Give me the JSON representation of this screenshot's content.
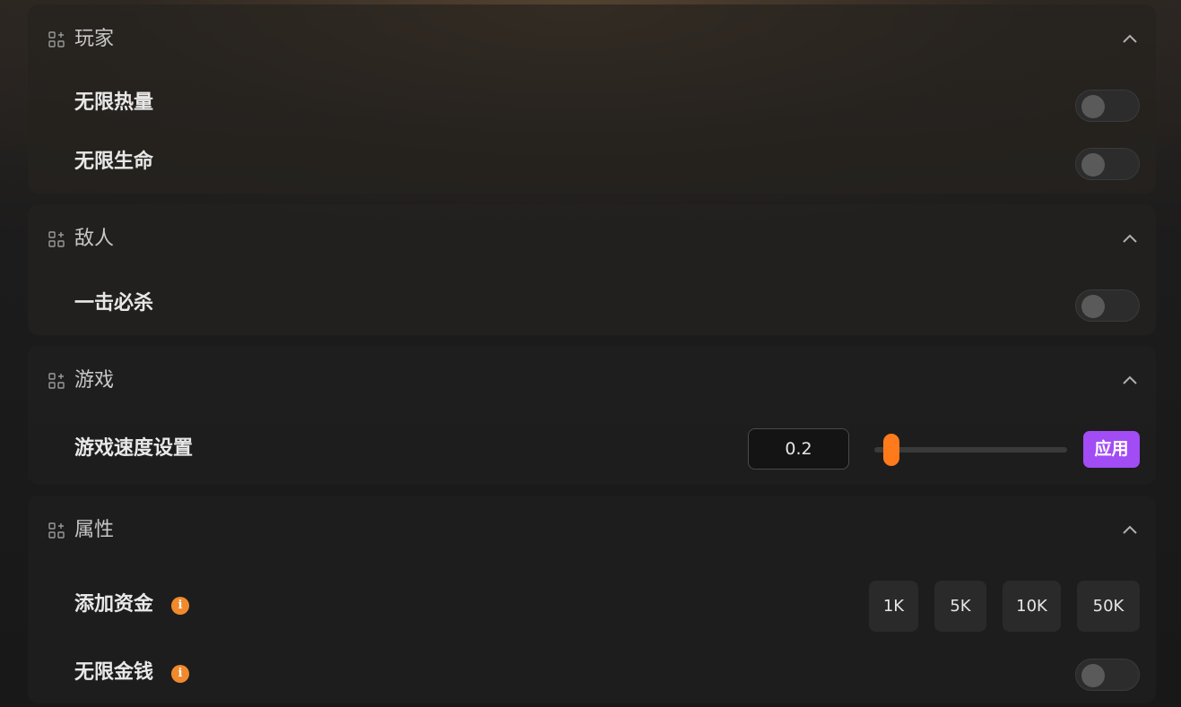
{
  "sections": {
    "player": {
      "title": "玩家",
      "rows": [
        {
          "label": "无限热量",
          "enabled": false
        },
        {
          "label": "无限生命",
          "enabled": false
        }
      ]
    },
    "enemy": {
      "title": "敌人",
      "rows": [
        {
          "label": "一击必杀",
          "enabled": false
        }
      ]
    },
    "game": {
      "title": "游戏",
      "speed": {
        "label": "游戏速度设置",
        "value": "0.2",
        "slider_fraction": 0.05,
        "apply_label": "应用"
      }
    },
    "attributes": {
      "title": "属性",
      "add_funds": {
        "label": "添加资金",
        "info_glyph": "i",
        "amounts": [
          "1K",
          "5K",
          "10K",
          "50K"
        ]
      },
      "infinite_money": {
        "label": "无限金钱",
        "info_glyph": "i",
        "enabled": false
      }
    }
  },
  "icons": {
    "section_icon": "grid-plus-icon",
    "collapse_icon": "chevron-up-icon",
    "info_icon": "info-icon"
  },
  "colors": {
    "accent_orange": "#ff7a1a",
    "apply_purple": "#a24cf5",
    "info_orange": "#f08a2d"
  }
}
